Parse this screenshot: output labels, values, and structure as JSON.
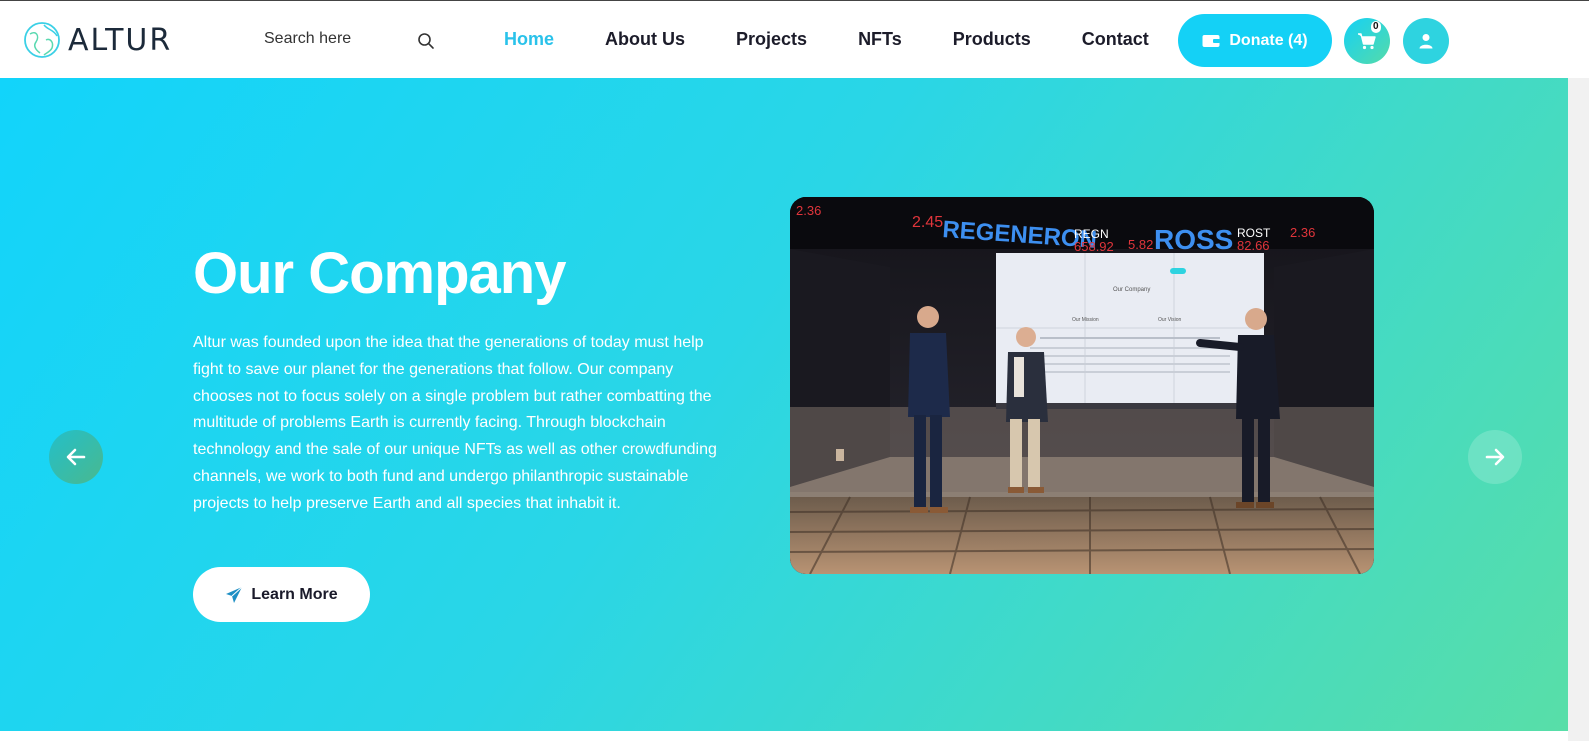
{
  "header": {
    "logo_text": "ALTUR",
    "search": {
      "placeholder": "Search here"
    },
    "nav": [
      {
        "label": "Home",
        "active": true
      },
      {
        "label": "About Us",
        "active": false
      },
      {
        "label": "Projects",
        "active": false
      },
      {
        "label": "NFTs",
        "active": false
      },
      {
        "label": "Products",
        "active": false
      },
      {
        "label": "Contact",
        "active": false
      }
    ],
    "donate_label": "Donate (4)",
    "cart_count": "0"
  },
  "hero": {
    "title": "Our Company",
    "body": "Altur was founded upon the idea that the generations of today must help fight to save our planet for the generations that follow. Our company chooses not to focus solely on a single problem but rather combatting the multitude of problems Earth is currently facing. Through blockchain technology and the sale of our unique NFTs as well as other crowdfunding channels, we work to both fund and undergo philanthropic sustainable projects to help preserve Earth and all species that inhabit it.",
    "cta_label": "Learn More",
    "photo": {
      "ticker": [
        "2.45",
        "REGENERON",
        "REGN",
        "658.92",
        "5.82",
        "ROSS",
        "ROST",
        "82.66",
        "2.36"
      ],
      "screen_heading": "Our Company",
      "screen_left_heading": "Our Mission",
      "screen_right_heading": "Our Vision"
    }
  },
  "colors": {
    "accent": "#14d1f6",
    "gradient_end": "#58dea8",
    "nav_active": "#2ac2ea",
    "text_dark": "#1c1c2a"
  },
  "icons": {
    "search": "search-icon",
    "wallet": "wallet-icon",
    "cart": "cart-icon",
    "user": "user-icon",
    "prev": "arrow-left-icon",
    "next": "arrow-right-icon",
    "send": "paper-plane-icon"
  }
}
